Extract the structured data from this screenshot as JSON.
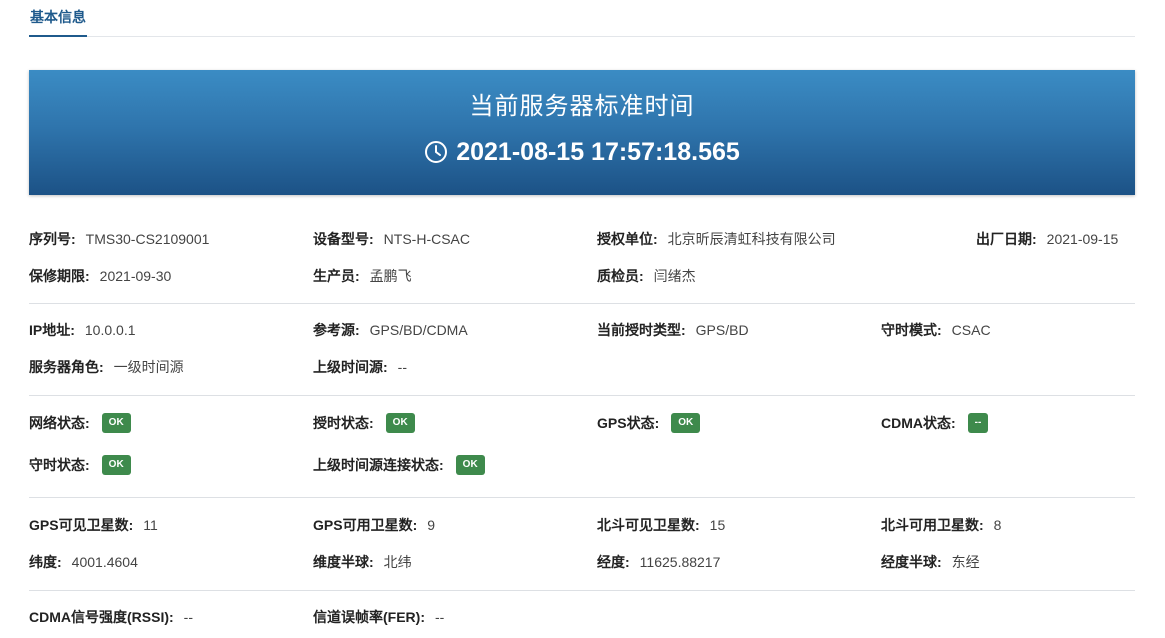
{
  "tabs": {
    "active": "基本信息"
  },
  "banner": {
    "title": "当前服务器标准时间",
    "time": "2021-08-15 17:57:18.565",
    "icon": "clock-icon"
  },
  "device": {
    "serial_label": "序列号:",
    "serial": "TMS30-CS2109001",
    "model_label": "设备型号:",
    "model": "NTS-H-CSAC",
    "licensee_label": "授权单位:",
    "licensee": "北京昕辰清虹科技有限公司",
    "factory_date_label": "出厂日期:",
    "factory_date": "2021-09-15",
    "warranty_label": "保修期限:",
    "warranty": "2021-09-30",
    "producer_label": "生产员:",
    "producer": "孟鹏飞",
    "inspector_label": "质检员:",
    "inspector": "闫绪杰"
  },
  "network": {
    "ip_label": "IP地址:",
    "ip": "10.0.0.1",
    "ref_label": "参考源:",
    "ref": "GPS/BD/CDMA",
    "timing_type_label": "当前授时类型:",
    "timing_type": "GPS/BD",
    "hold_mode_label": "守时模式:",
    "hold_mode": "CSAC",
    "role_label": "服务器角色:",
    "role": "一级时间源",
    "upper_label": "上级时间源:",
    "upper": "--"
  },
  "status": {
    "net_label": "网络状态:",
    "net": "OK",
    "timing_label": "授时状态:",
    "timing": "OK",
    "gps_label": "GPS状态:",
    "gps": "OK",
    "cdma_label": "CDMA状态:",
    "cdma": "--",
    "hold_label": "守时状态:",
    "hold": "OK",
    "upper_conn_label": "上级时间源连接状态:",
    "upper_conn": "OK",
    "ok_color": "#3e8a4c"
  },
  "satellite": {
    "gps_visible_label": "GPS可见卫星数:",
    "gps_visible": "11",
    "gps_usable_label": "GPS可用卫星数:",
    "gps_usable": "9",
    "bd_visible_label": "北斗可见卫星数:",
    "bd_visible": "15",
    "bd_usable_label": "北斗可用卫星数:",
    "bd_usable": "8",
    "lat_label": "纬度:",
    "lat": "4001.4604",
    "lat_hemi_label": "维度半球:",
    "lat_hemi": "北纬",
    "lon_label": "经度:",
    "lon": "11625.88217",
    "lon_hemi_label": "经度半球:",
    "lon_hemi": "东经"
  },
  "cdma": {
    "rssi_label": "CDMA信号强度(RSSI):",
    "rssi": "--",
    "fer_label": "信道误帧率(FER):",
    "fer": "--"
  }
}
